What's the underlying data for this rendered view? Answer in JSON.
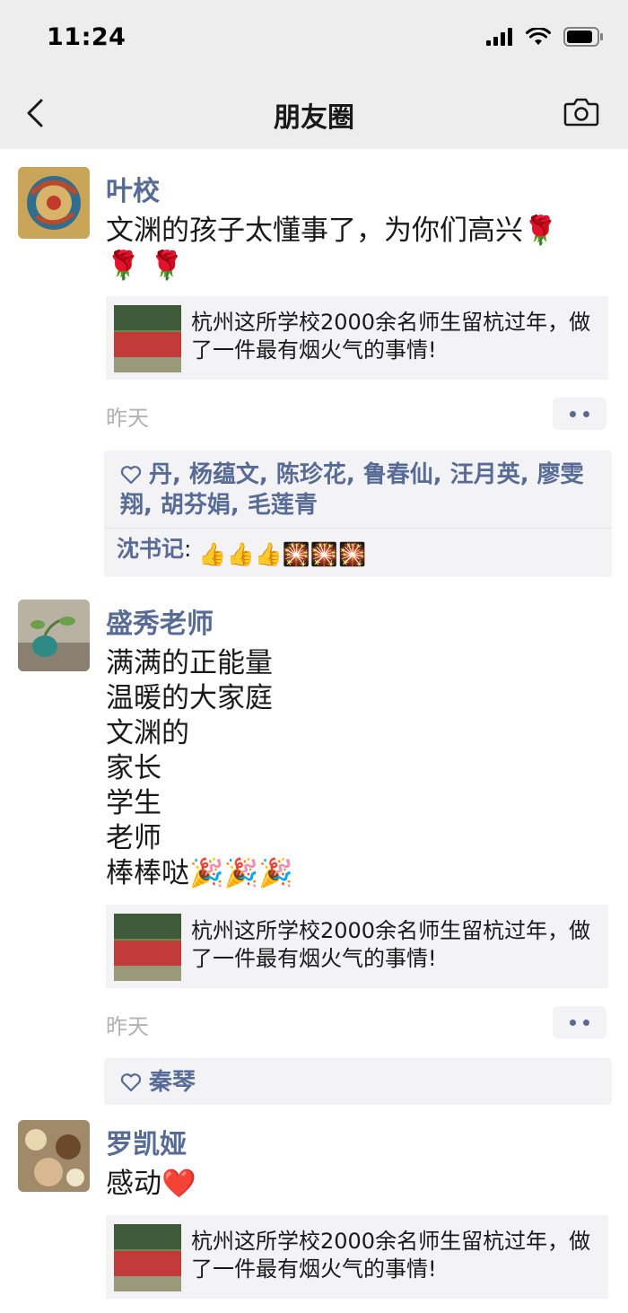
{
  "status": {
    "time": "11:24"
  },
  "nav": {
    "title": "朋友圈"
  },
  "posts": [
    {
      "author": "叶校",
      "text_line1": "文渊的孩子太懂事了，为你们高兴🌹",
      "text_line2": "🌹 🌹",
      "link_title": "杭州这所学校2000余名师生留杭过年，做了一件最有烟火气的事情!",
      "time": "昨天",
      "likes": "丹, 杨蕴文, 陈珍花, 鲁春仙, 汪月英, 廖雯翔, 胡芬娟, 毛莲青",
      "comment_author": "沈书记",
      "comment_sep": ": ",
      "comment_emojis": "👍👍👍🎇🎇🎇"
    },
    {
      "author": "盛秀老师",
      "lines": [
        "满满的正能量",
        "温暖的大家庭",
        "文渊的",
        "家长",
        "学生",
        "老师",
        "棒棒哒🎉🎉🎉"
      ],
      "link_title": "杭州这所学校2000余名师生留杭过年，做了一件最有烟火气的事情!",
      "time": "昨天",
      "likes": "秦琴"
    },
    {
      "author": "罗凯娅",
      "text": "感动❤️",
      "link_title": "杭州这所学校2000余名师生留杭过年，做了一件最有烟火气的事情!"
    }
  ]
}
